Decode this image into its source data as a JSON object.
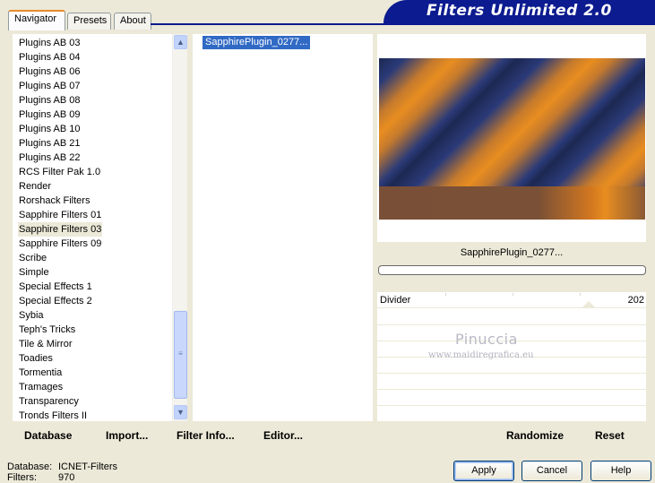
{
  "tabs": [
    {
      "label": "Navigator"
    },
    {
      "label": "Presets"
    },
    {
      "label": "About"
    }
  ],
  "header": {
    "title": "Filters Unlimited 2.0"
  },
  "categories": [
    "Plugins AB 03",
    "Plugins AB 04",
    "Plugins AB 06",
    "Plugins AB 07",
    "Plugins AB 08",
    "Plugins AB 09",
    "Plugins AB 10",
    "Plugins AB 21",
    "Plugins AB 22",
    "RCS Filter Pak 1.0",
    "Render",
    "Rorshack Filters",
    "Sapphire Filters 01",
    "Sapphire Filters 03",
    "Sapphire Filters 09",
    "Scribe",
    "Simple",
    "Special Effects 1",
    "Special Effects 2",
    "Sybia",
    "Teph's Tricks",
    "Tile & Mirror",
    "Toadies",
    "Tormentia",
    "Tramages",
    "Transparency",
    "Tronds Filters II"
  ],
  "selected_category": "Sapphire Filters 03",
  "filters": [
    "SapphirePlugin_0277..."
  ],
  "preview": {
    "filter_name": "SapphirePlugin_0277...",
    "colors": {
      "navy": "#1c2852",
      "orange": "#e88d20",
      "brown": "#7a4f37"
    }
  },
  "params": [
    {
      "label": "Divider",
      "value": "202"
    }
  ],
  "watermark": {
    "line1": "Pinuccia",
    "line2": "www.maidiregrafica.eu"
  },
  "bottom_links": {
    "database": "Database",
    "import": "Import...",
    "filter_info": "Filter Info...",
    "editor": "Editor...",
    "randomize": "Randomize",
    "reset": "Reset"
  },
  "status": {
    "database_label": "Database:",
    "database_value": "ICNET-Filters",
    "filters_label": "Filters:",
    "filters_value": "970"
  },
  "buttons": {
    "apply": "Apply",
    "cancel": "Cancel",
    "help": "Help"
  }
}
